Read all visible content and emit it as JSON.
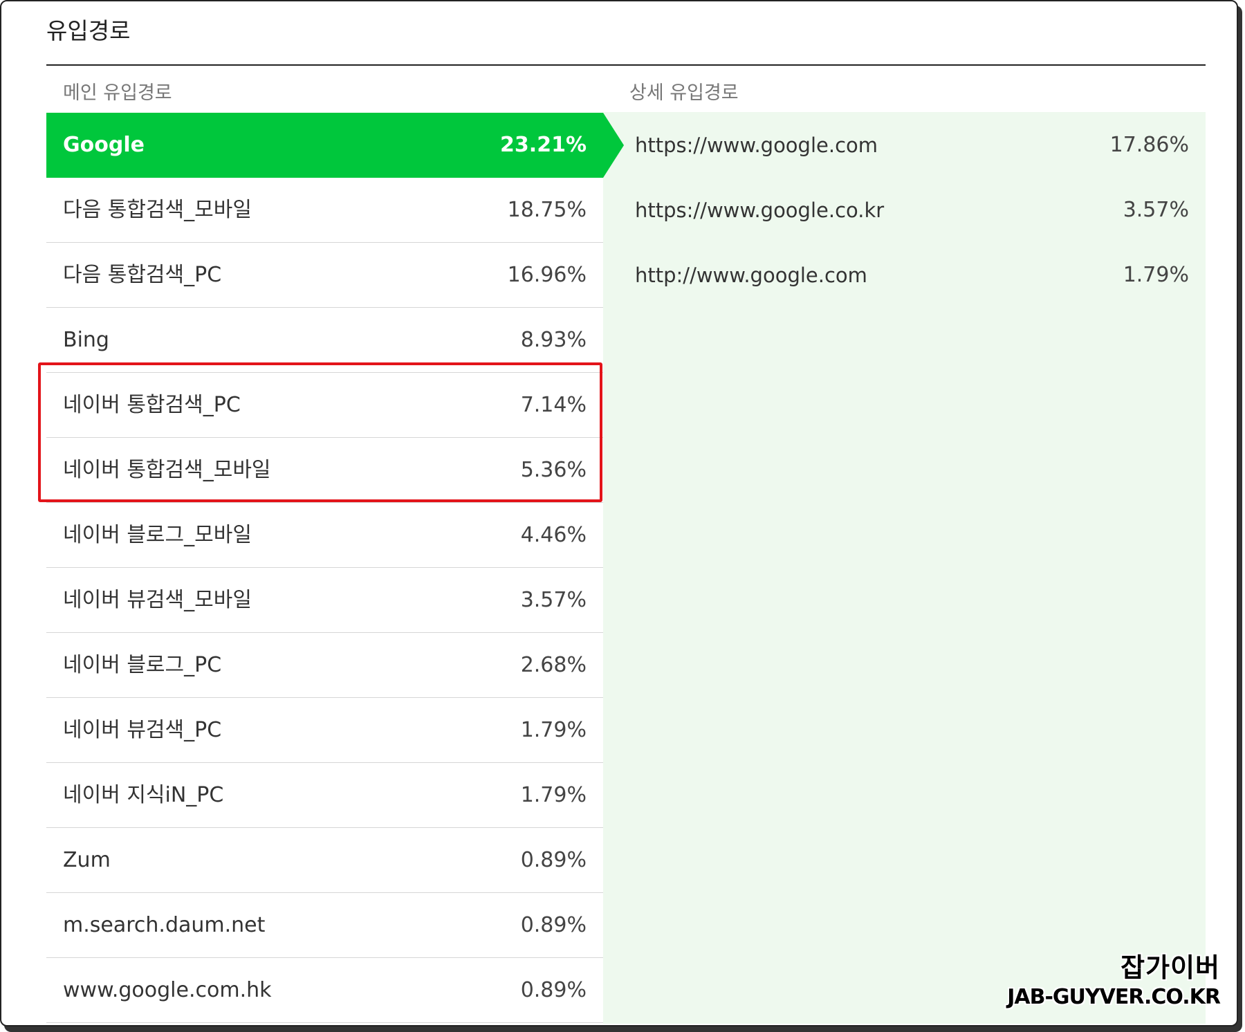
{
  "section": {
    "title": "유입경로"
  },
  "columns": {
    "main": "메인 유입경로",
    "detail": "상세 유입경로"
  },
  "main_rows": [
    {
      "label": "Google",
      "pct": "23.21%"
    },
    {
      "label": "다음 통합검색_모바일",
      "pct": "18.75%"
    },
    {
      "label": "다음 통합검색_PC",
      "pct": "16.96%"
    },
    {
      "label": "Bing",
      "pct": "8.93%"
    },
    {
      "label": "네이버 통합검색_PC",
      "pct": "7.14%"
    },
    {
      "label": "네이버 통합검색_모바일",
      "pct": "5.36%"
    },
    {
      "label": "네이버 블로그_모바일",
      "pct": "4.46%"
    },
    {
      "label": "네이버 뷰검색_모바일",
      "pct": "3.57%"
    },
    {
      "label": "네이버 블로그_PC",
      "pct": "2.68%"
    },
    {
      "label": "네이버 뷰검색_PC",
      "pct": "1.79%"
    },
    {
      "label": "네이버 지식iN_PC",
      "pct": "1.79%"
    },
    {
      "label": "Zum",
      "pct": "0.89%"
    },
    {
      "label": "m.search.daum.net",
      "pct": "0.89%"
    },
    {
      "label": "www.google.com.hk",
      "pct": "0.89%"
    }
  ],
  "detail_rows": [
    {
      "url": "https://www.google.com",
      "pct": "17.86%"
    },
    {
      "url": "https://www.google.co.kr",
      "pct": "3.57%"
    },
    {
      "url": "http://www.google.com",
      "pct": "1.79%"
    }
  ],
  "watermark": {
    "ko": "잡가이버",
    "en": "JAB-GUYVER.CO.KR"
  },
  "colors": {
    "active": "#00c73c",
    "detail_bg": "#eef9ee",
    "highlight": "#e3141a"
  }
}
